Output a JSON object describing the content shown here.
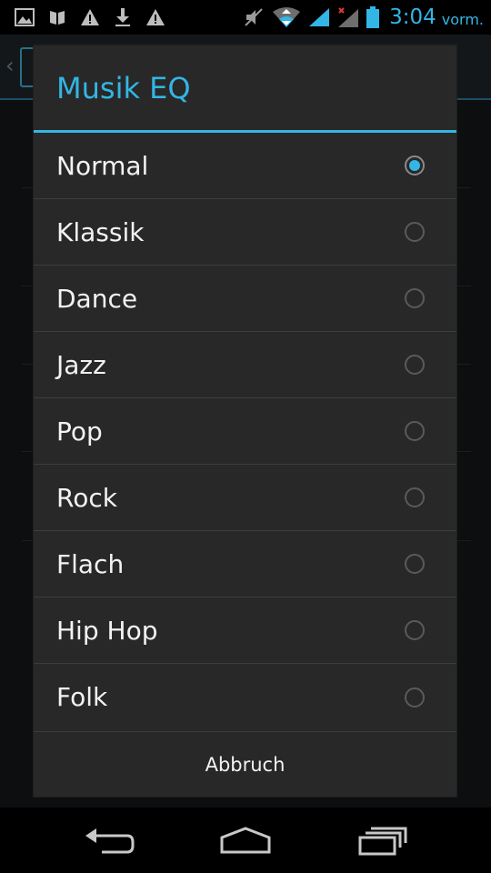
{
  "status_bar": {
    "left_icons": [
      "image-icon",
      "book-icon",
      "warning-icon",
      "download-icon",
      "warning-icon"
    ],
    "right_icons": [
      "mute-icon",
      "wifi-icon",
      "signal-icon",
      "signal-nodata-icon",
      "battery-icon"
    ],
    "time": "3:04",
    "ampm": "vorm."
  },
  "dialog": {
    "title": "Musik EQ",
    "options": [
      {
        "label": "Normal",
        "selected": true
      },
      {
        "label": "Klassik",
        "selected": false
      },
      {
        "label": "Dance",
        "selected": false
      },
      {
        "label": "Jazz",
        "selected": false
      },
      {
        "label": "Pop",
        "selected": false
      },
      {
        "label": "Rock",
        "selected": false
      },
      {
        "label": "Flach",
        "selected": false
      },
      {
        "label": "Hip Hop",
        "selected": false
      },
      {
        "label": "Folk",
        "selected": false
      }
    ],
    "cancel_label": "Abbruch"
  },
  "nav_bar": {
    "buttons": [
      "back-icon",
      "home-icon",
      "recent-apps-icon"
    ]
  },
  "colors": {
    "accent": "#33b5e5",
    "dialog_bg": "#282828",
    "divider": "#3d3d3d"
  }
}
